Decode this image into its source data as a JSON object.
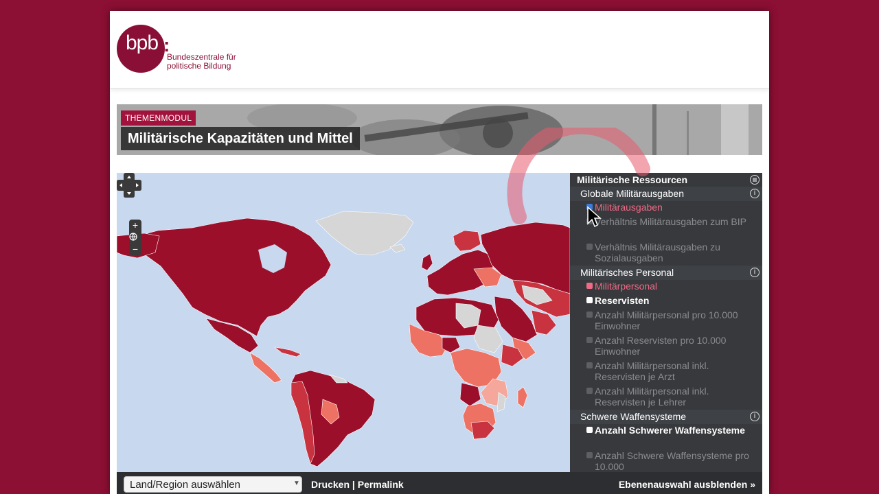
{
  "brand": {
    "mark": "bpb",
    "colon": ":",
    "line1": "Bundeszentrale für",
    "line2": "politische Bildung"
  },
  "banner": {
    "badge": "THEMENMODUL",
    "title": "Militärische Kapazitäten und Mittel"
  },
  "panel": {
    "title": "Militärische Ressourcen",
    "sections": [
      {
        "label": "Globale Militärausgaben",
        "items": [
          {
            "label": "Militärausgaben",
            "state": "active"
          },
          {
            "label": "Verhältnis Militärausgaben zum BIP",
            "state": "disabled"
          },
          {
            "label": "Verhältnis Militärausgaben zu Sozialausgaben",
            "state": "disabled"
          }
        ]
      },
      {
        "label": "Militärisches Personal",
        "items": [
          {
            "label": "Militärpersonal",
            "state": "pink"
          },
          {
            "label": "Reservisten",
            "state": "on"
          },
          {
            "label": "Anzahl Militärpersonal pro 10.000 Einwohner",
            "state": "disabled"
          },
          {
            "label": "Anzahl Reservisten pro 10.000 Einwohner",
            "state": "disabled"
          },
          {
            "label": "Anzahl Militärpersonal inkl. Reservisten je Arzt",
            "state": "disabled"
          },
          {
            "label": "Anzahl Militärpersonal inkl. Reservisten je Lehrer",
            "state": "disabled"
          }
        ]
      },
      {
        "label": "Schwere Waffensysteme",
        "items": [
          {
            "label": "Anzahl Schwerer Waffensysteme",
            "state": "on"
          },
          {
            "label": "Anzahl Schwere Waffensysteme pro 10.000",
            "state": "disabled"
          }
        ]
      }
    ]
  },
  "toolbar": {
    "select_value": "Land/Region auswählen",
    "print": "Drucken",
    "sep": "|",
    "permalink": "Permalink",
    "hide_layers": "Ebenenauswahl ausblenden »"
  },
  "map_controls": {
    "zoom_in": "+",
    "zoom_out": "−"
  },
  "colors": {
    "page_bg": "#8c0f34",
    "dark_red": "#9b0f2a",
    "mid_red": "#c9323f",
    "light_red": "#ee7264",
    "pink": "#f4a79a",
    "no_data": "#d6d6d6",
    "ocean": "#c7d8ef",
    "accent_pink": "#f06a86"
  }
}
